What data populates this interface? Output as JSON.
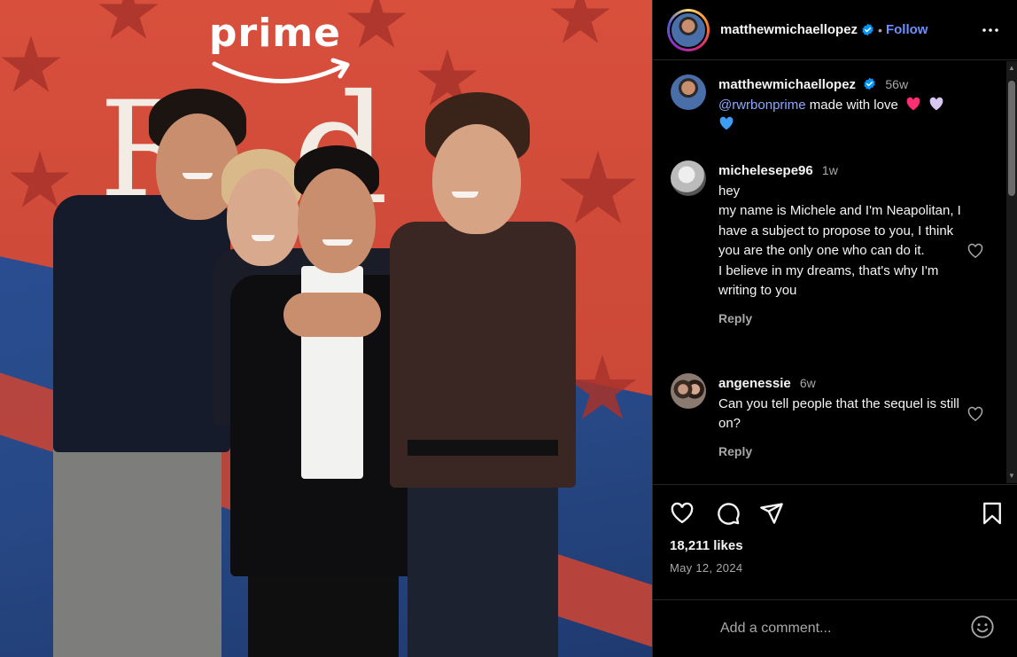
{
  "post": {
    "username": "matthewmichaellopez",
    "follow_label": "Follow",
    "separator": "•",
    "caption": {
      "username": "matthewmichaellopez",
      "time": "56w",
      "mention": "@rwrbonprime",
      "text": " made with love",
      "emojis": [
        "pink-heart",
        "lavender-heart",
        "blue-heart"
      ]
    },
    "photo": {
      "brand_text": "prime",
      "backdrop_letters": "Red"
    },
    "likes": "18,211 likes",
    "date": "May 12, 2024"
  },
  "comments": [
    {
      "username": "michelesepe96",
      "time": "1w",
      "lines": [
        "hey",
        "my name is Michele and I'm Neapolitan, I have a subject to propose to you, I think you are the only one who can do it.",
        "I believe in my dreams, that's why I'm writing to you"
      ],
      "reply_label": "Reply"
    },
    {
      "username": "angenessie",
      "time": "6w",
      "lines": [
        "Can you tell people that the sequel is still on?"
      ],
      "reply_label": "Reply"
    }
  ],
  "add_comment": {
    "placeholder": "Add a comment..."
  },
  "icons": {
    "more": "more-options-icon",
    "like": "heart-icon",
    "comment": "comment-icon",
    "share": "share-icon",
    "save": "bookmark-icon",
    "emoji": "emoji-icon",
    "verified": "verified-badge-icon"
  },
  "colors": {
    "background": "#000000",
    "link": "#6e8fff",
    "mention": "#8da8ff",
    "verified": "#0095f6",
    "muted": "#a8a8a8",
    "divider": "#262626",
    "pink_heart": "#ff2e72",
    "lavender_heart": "#d9c7f2",
    "blue_heart": "#3d9df5"
  }
}
